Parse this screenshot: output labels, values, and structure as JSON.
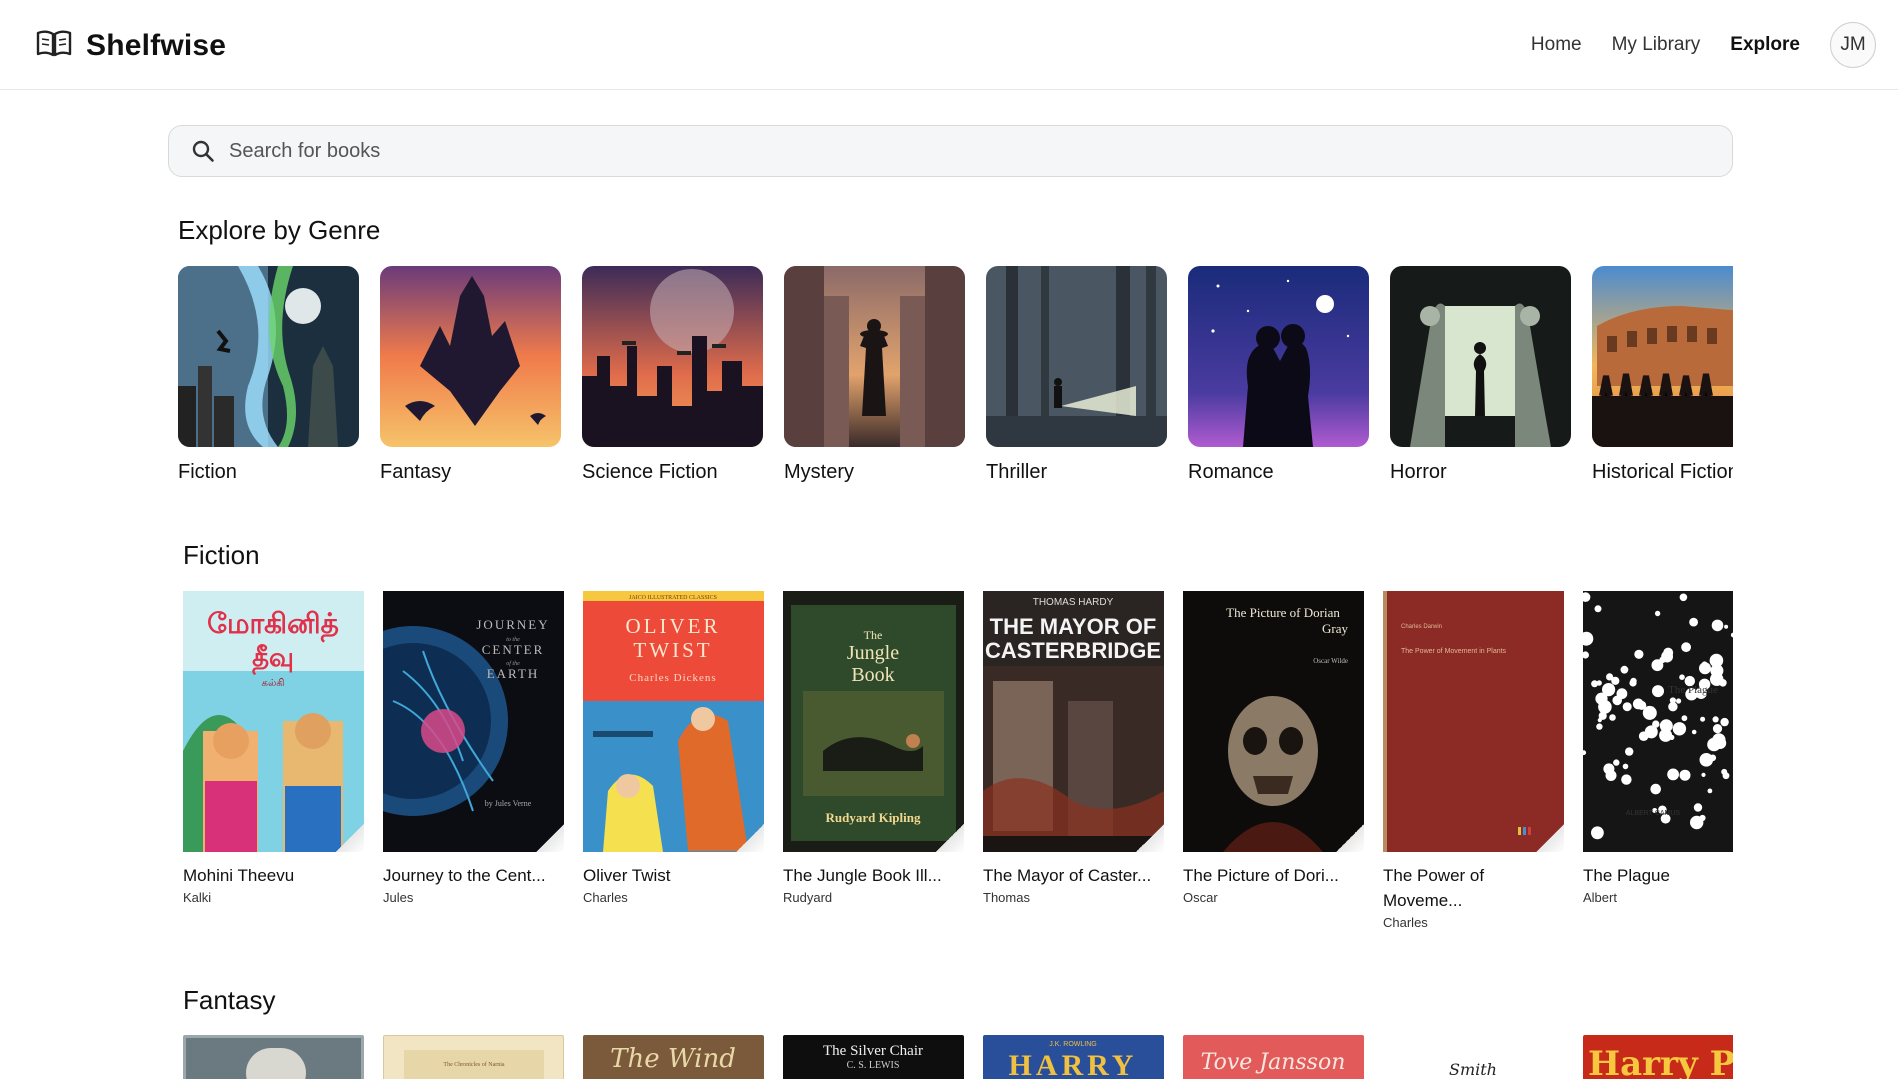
{
  "app": {
    "name": "Shelfwise"
  },
  "nav": {
    "home": "Home",
    "library": "My Library",
    "explore": "Explore",
    "avatar_initials": "JM"
  },
  "search": {
    "placeholder": "Search for books",
    "value": ""
  },
  "sections": {
    "genres_title": "Explore by Genre",
    "fiction_title": "Fiction",
    "fantasy_title": "Fantasy"
  },
  "genres": [
    {
      "label": "Fiction"
    },
    {
      "label": "Fantasy"
    },
    {
      "label": "Science Fiction"
    },
    {
      "label": "Mystery"
    },
    {
      "label": "Thriller"
    },
    {
      "label": "Romance"
    },
    {
      "label": "Horror"
    },
    {
      "label": "Historical Fiction"
    }
  ],
  "fiction_books": [
    {
      "title": "Mohini Theevu",
      "author": "Kalki",
      "cover": {
        "top_text": "மோகினித்",
        "mid_text": "தீவு",
        "small": "கல்கி"
      }
    },
    {
      "title": "Journey to the Cent...",
      "author": "Jules",
      "cover": {
        "l1": "JOURNEY",
        "l2": "to the",
        "l3": "CENTER",
        "l4": "of the",
        "l5": "EARTH",
        "by": "by Jules Verne"
      }
    },
    {
      "title": "Oliver Twist",
      "author": "Charles",
      "cover": {
        "series": "JAICO ILLUSTRATED CLASSICS",
        "l1": "OLIVER",
        "l2": "TWIST",
        "by": "Charles Dickens"
      }
    },
    {
      "title": "The Jungle Book Ill...",
      "author": "Rudyard",
      "cover": {
        "l1": "The",
        "l2": "Jungle",
        "l3": "Book",
        "by": "Rudyard Kipling"
      }
    },
    {
      "title": "The Mayor of Caster...",
      "author": "Thomas",
      "cover": {
        "by": "THOMAS HARDY",
        "l1": "THE MAYOR OF",
        "l2": "CASTERBRIDGE"
      }
    },
    {
      "title": "The Picture of Dori...",
      "author": "Oscar",
      "cover": {
        "l1": "The Picture of Dorian",
        "l2": "Gray",
        "by": "Oscar Wilde"
      }
    },
    {
      "title": "The Power of Moveme...",
      "author": "Charles",
      "cover": {
        "by": "Charles Darwin",
        "l1": "The Power of Movement in Plants"
      }
    },
    {
      "title": "The Plague",
      "author": "Albert",
      "cover": {
        "l1": "The Plague",
        "by": "ALBERT CAMUS"
      }
    }
  ],
  "fantasy_books": [
    {
      "cover_text": ""
    },
    {
      "cover_text": "The Chronicles of Narnia"
    },
    {
      "cover_text": "The Wind"
    },
    {
      "cover_text": "The Silver Chair",
      "cover_sub": "C. S. LEWIS"
    },
    {
      "cover_text": "HARRY",
      "cover_sub": "J.K. ROWLING"
    },
    {
      "cover_text": "Tove Jansson"
    },
    {
      "cover_text": "Smith"
    },
    {
      "cover_text": "Harry Potter"
    }
  ]
}
